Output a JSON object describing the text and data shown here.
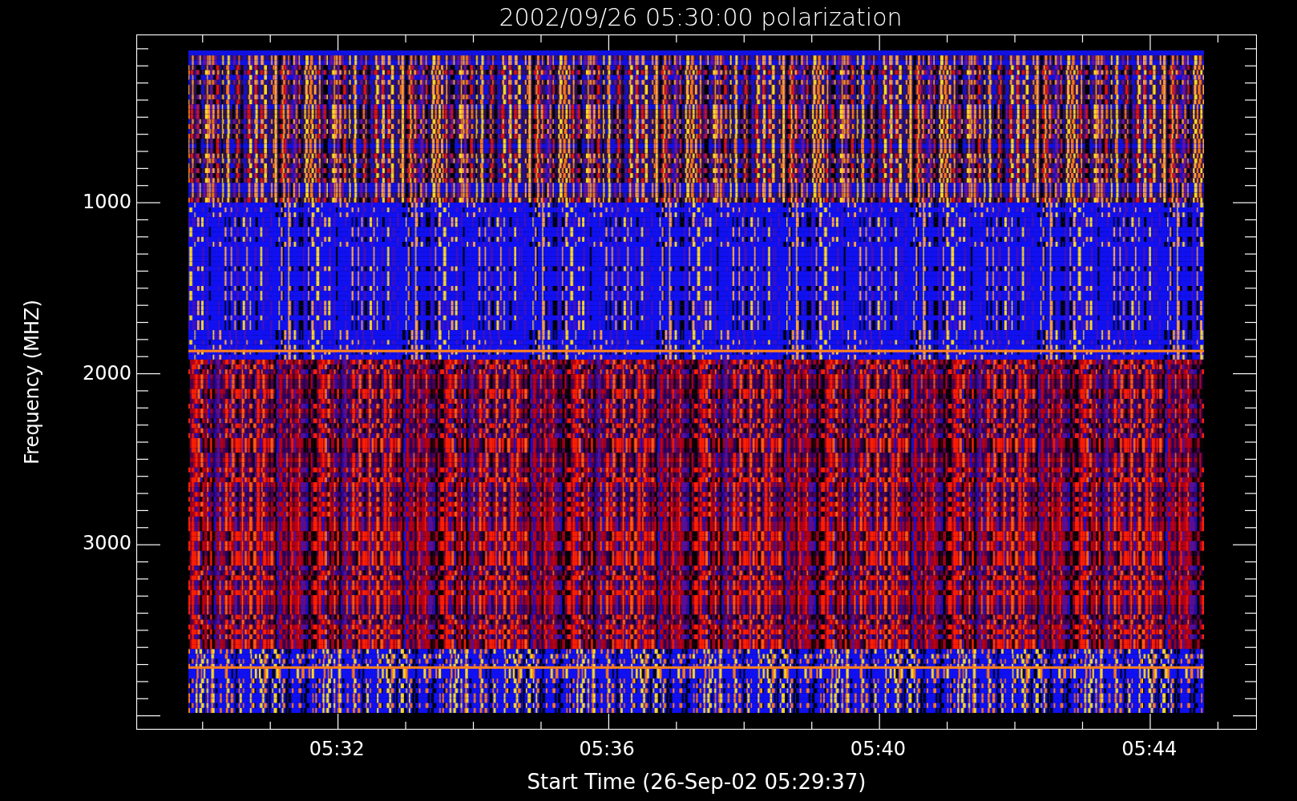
{
  "title": "2002/09/26 05:30:00 polarization",
  "y_axis": {
    "label": "Frequency (MHZ)",
    "ticks": [
      "1000",
      "2000",
      "3000"
    ]
  },
  "x_axis": {
    "label": "Start Time (26-Sep-02 05:29:37)",
    "ticks": [
      "05:32",
      "05:36",
      "05:40",
      "05:44"
    ]
  }
}
